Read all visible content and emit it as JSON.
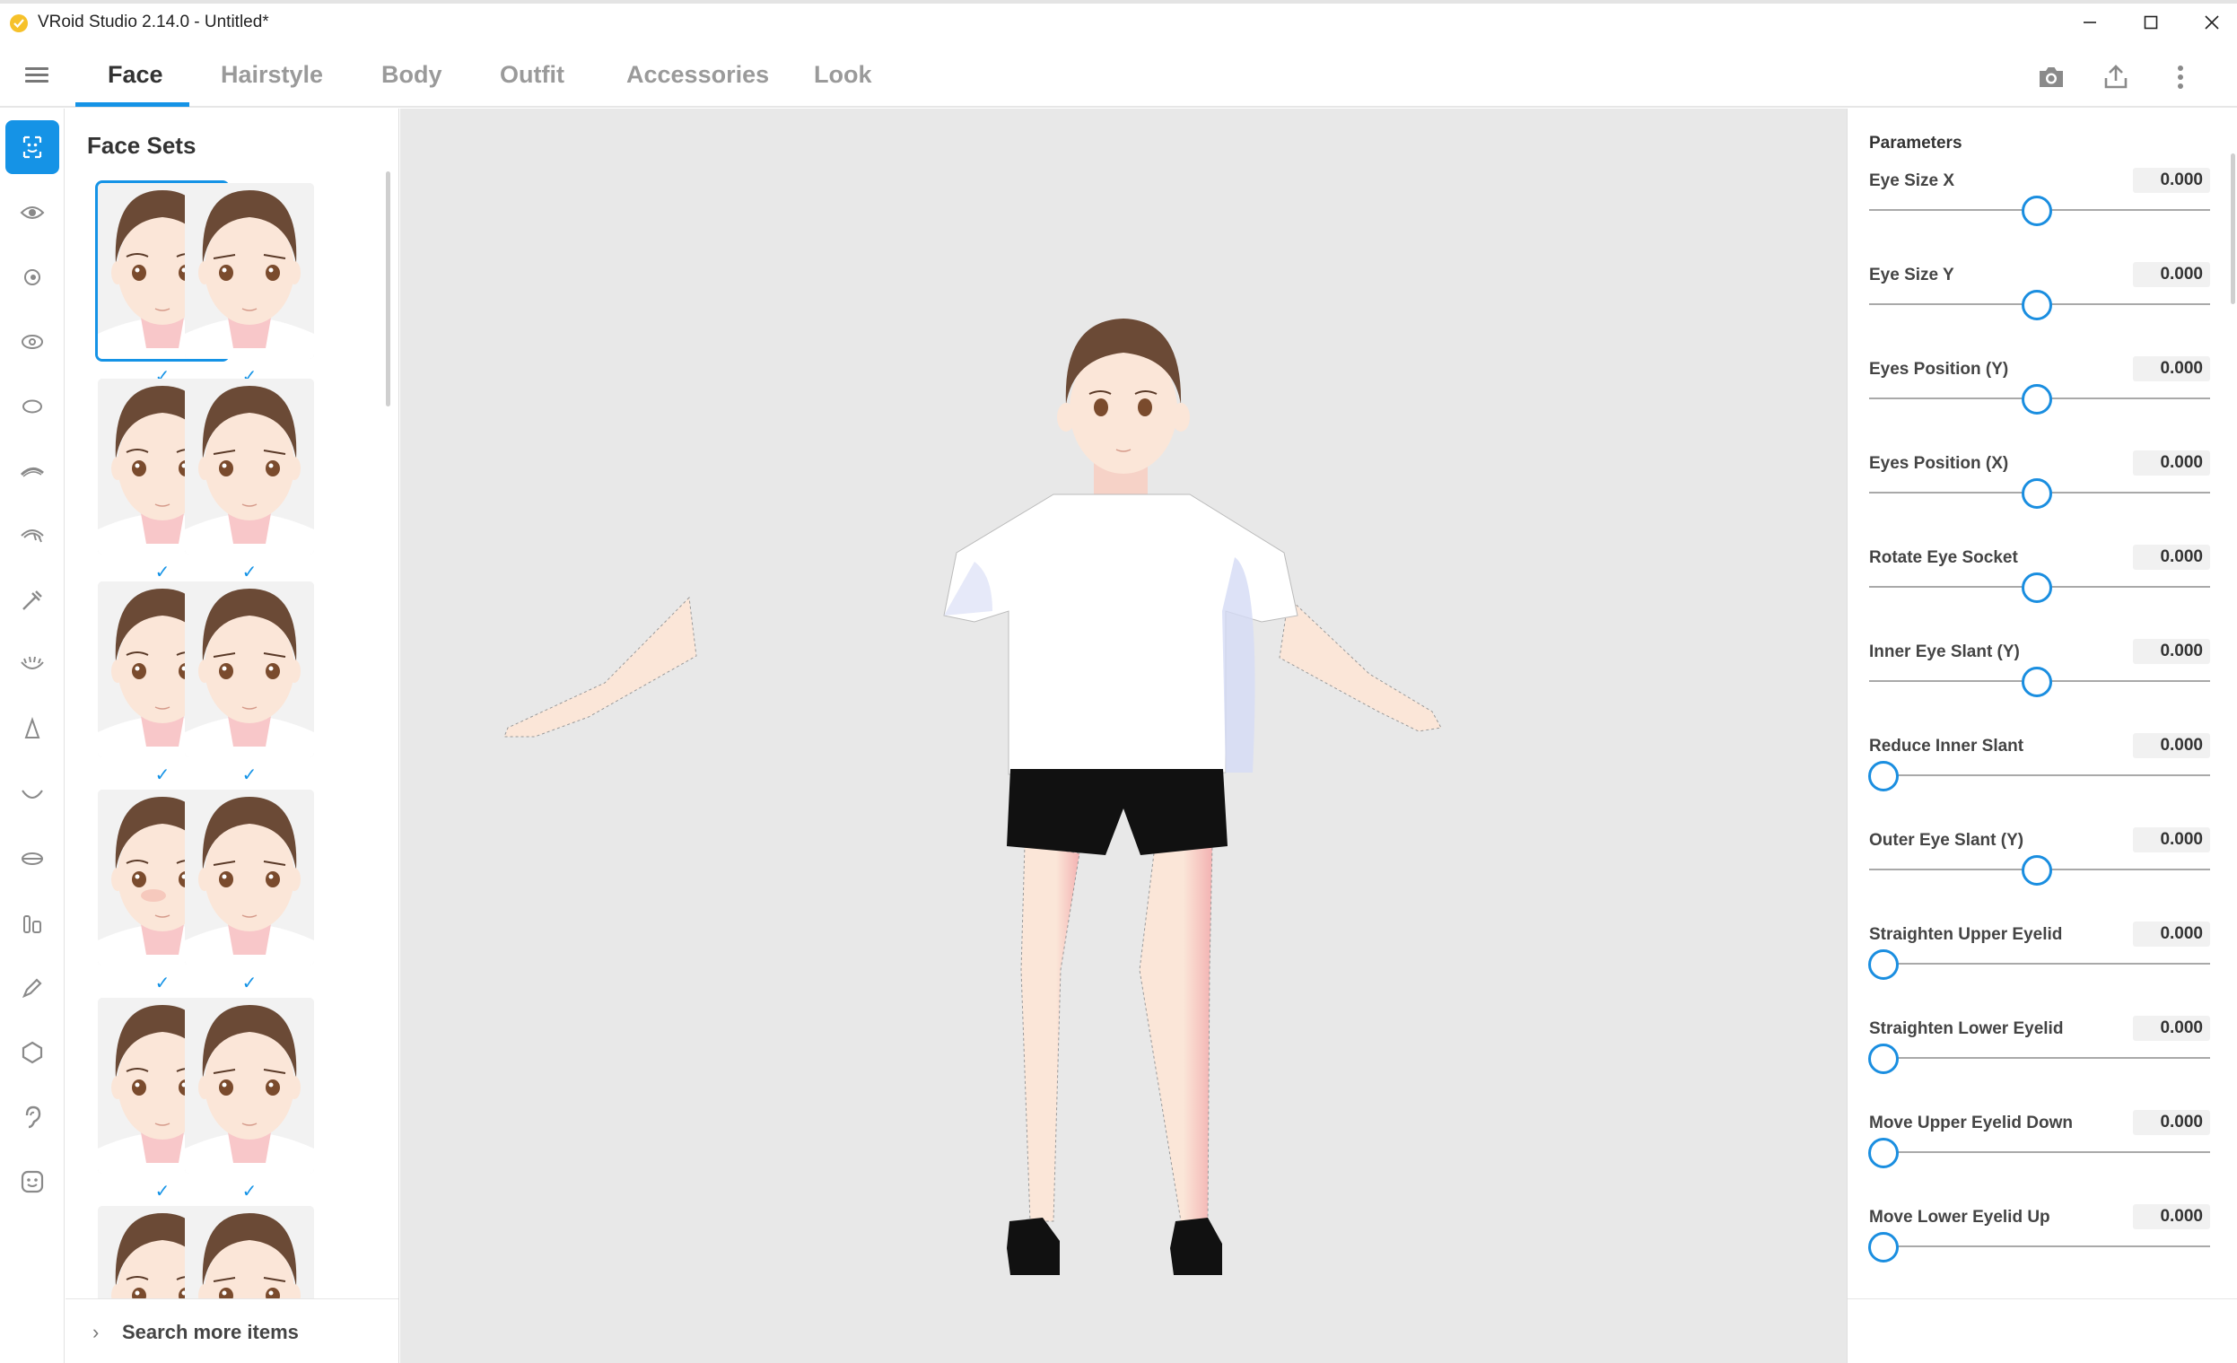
{
  "window": {
    "title": "VRoid Studio 2.14.0 - Untitled*"
  },
  "nav": {
    "tabs": [
      {
        "label": "Face",
        "active": true
      },
      {
        "label": "Hairstyle",
        "active": false
      },
      {
        "label": "Body",
        "active": false
      },
      {
        "label": "Outfit",
        "active": false
      },
      {
        "label": "Accessories",
        "active": false
      },
      {
        "label": "Look",
        "active": false
      }
    ],
    "icons": [
      "camera-icon",
      "export-icon",
      "more-vertical-icon"
    ]
  },
  "rail": {
    "items": [
      "face-set-icon",
      "eye-icon",
      "iris-icon",
      "eyeball-icon",
      "face-outline-icon",
      "eyebrow-icon",
      "eyelash-icon",
      "brush-icon",
      "eyelid-icon",
      "nose-icon",
      "mouth-icon",
      "lips-icon",
      "teeth-icon",
      "pen-icon",
      "head-shape-icon",
      "ear-icon",
      "emoji-icon"
    ],
    "active_index": 0
  },
  "face_sets": {
    "title": "Face Sets",
    "search_more": "Search more items",
    "checkmark": "✓",
    "selected_index": 0
  },
  "params": {
    "title": "Parameters",
    "items": [
      {
        "label": "Eye Size X",
        "value": "0.000",
        "position": 0.5
      },
      {
        "label": "Eye Size Y",
        "value": "0.000",
        "position": 0.5
      },
      {
        "label": "Eyes Position (Y)",
        "value": "0.000",
        "position": 0.5
      },
      {
        "label": "Eyes Position (X)",
        "value": "0.000",
        "position": 0.5
      },
      {
        "label": "Rotate Eye Socket",
        "value": "0.000",
        "position": 0.5
      },
      {
        "label": "Inner Eye Slant (Y)",
        "value": "0.000",
        "position": 0.5
      },
      {
        "label": "Reduce Inner Slant",
        "value": "0.000",
        "position": 0.0
      },
      {
        "label": "Outer Eye Slant (Y)",
        "value": "0.000",
        "position": 0.5
      },
      {
        "label": "Straighten Upper Eyelid",
        "value": "0.000",
        "position": 0.0
      },
      {
        "label": "Straighten Lower Eyelid",
        "value": "0.000",
        "position": 0.0
      },
      {
        "label": "Move Upper Eyelid Down",
        "value": "0.000",
        "position": 0.0
      },
      {
        "label": "Move Lower Eyelid Up",
        "value": "0.000",
        "position": 0.0
      }
    ]
  },
  "colors": {
    "accent": "#1593e6",
    "viewport_bg": "#e8e8e8",
    "hair": "#6b4a36",
    "skin": "#fbe6d8",
    "shorts": "#111111"
  }
}
